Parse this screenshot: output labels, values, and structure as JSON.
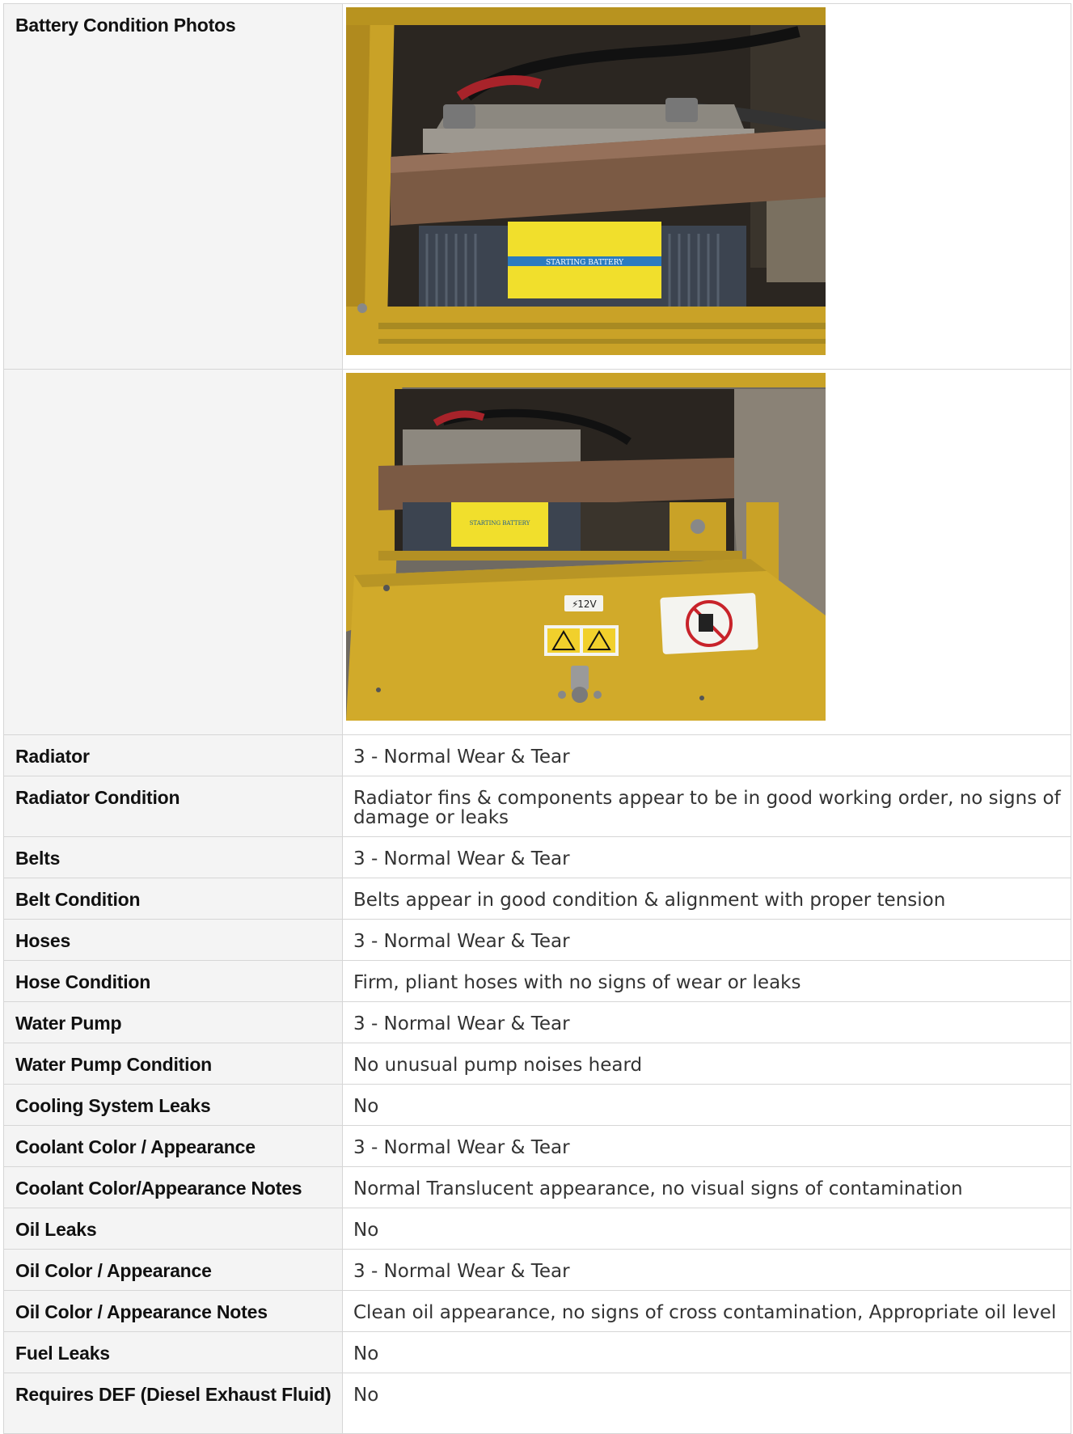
{
  "rows": [
    {
      "label": "Battery Condition Photos",
      "value": ""
    },
    {
      "label": "",
      "value": ""
    },
    {
      "label": "Radiator",
      "value": "3 - Normal Wear & Tear"
    },
    {
      "label": "Radiator Condition",
      "value": "Radiator fins & components appear to be in good working order, no signs of damage or leaks"
    },
    {
      "label": "Belts",
      "value": "3 - Normal Wear & Tear"
    },
    {
      "label": "Belt Condition",
      "value": "Belts appear in good condition & alignment with proper tension"
    },
    {
      "label": "Hoses",
      "value": "3 - Normal Wear & Tear"
    },
    {
      "label": "Hose Condition",
      "value": "Firm, pliant hoses with no signs of wear or leaks"
    },
    {
      "label": "Water Pump",
      "value": "3 - Normal Wear & Tear"
    },
    {
      "label": "Water Pump Condition",
      "value": "No unusual pump noises heard"
    },
    {
      "label": "Cooling System Leaks",
      "value": "No"
    },
    {
      "label": "Coolant Color / Appearance",
      "value": "3 - Normal Wear & Tear"
    },
    {
      "label": "Coolant Color/Appearance Notes",
      "value": "Normal Translucent appearance, no visual signs of contamination"
    },
    {
      "label": "Oil Leaks",
      "value": "No"
    },
    {
      "label": "Oil Color / Appearance",
      "value": "3 - Normal Wear & Tear"
    },
    {
      "label": "Oil Color / Appearance Notes",
      "value": "Clean oil appearance, no signs of cross contamination, Appropriate oil level"
    },
    {
      "label": "Fuel Leaks",
      "value": "No"
    },
    {
      "label": "Requires DEF (Diesel Exhaust Fluid)",
      "value": "No"
    }
  ],
  "photos": {
    "photo1": {
      "battery_label": "STARTING BATTERY"
    },
    "photo2": {
      "battery_label": "STARTING BATTERY",
      "voltage_label": "12V"
    }
  }
}
